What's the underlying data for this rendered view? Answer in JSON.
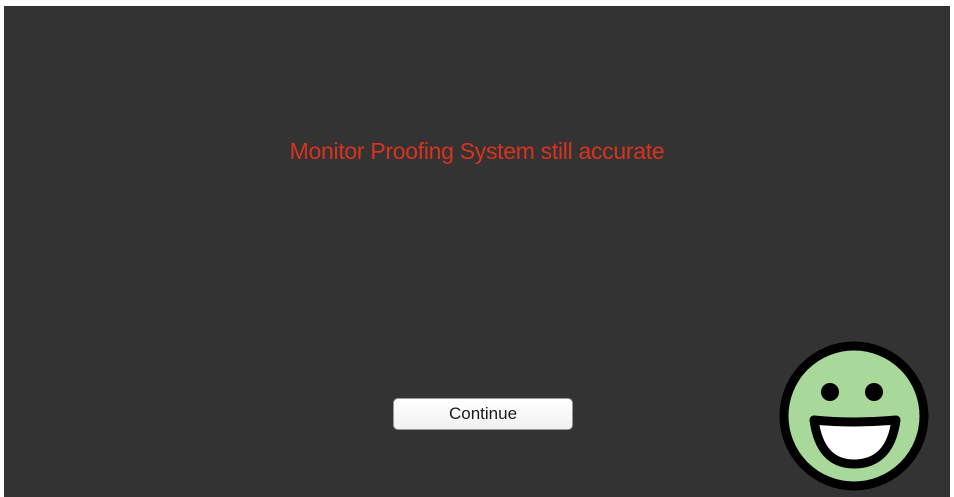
{
  "dialog": {
    "message": "Monitor Proofing System still accurate",
    "continue_label": "Continue"
  },
  "status_icon": {
    "name": "happy-smiley-icon",
    "face_color": "#a8d89a",
    "outline_color": "#000000"
  },
  "colors": {
    "background": "#333333",
    "message_text": "#d9331f"
  }
}
